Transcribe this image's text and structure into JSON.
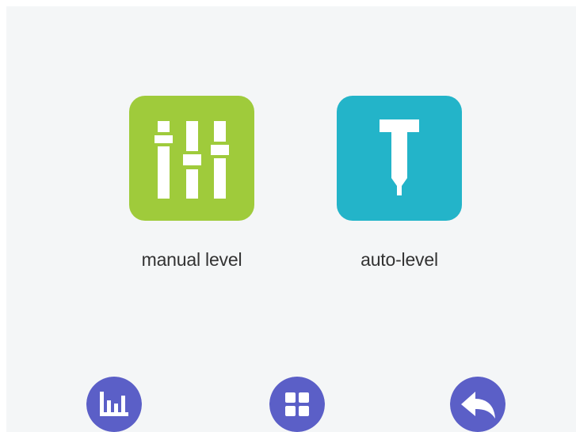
{
  "colors": {
    "background": "#f4f6f7",
    "manual_tile": "#9fcb3b",
    "auto_tile": "#23b4c9",
    "nav_button": "#5b5fc7",
    "icon_fill": "#ffffff",
    "label_text": "#333333"
  },
  "options": [
    {
      "id": "manual-level",
      "label": "manual level",
      "icon": "sliders-icon"
    },
    {
      "id": "auto-level",
      "label": "auto-level",
      "icon": "probe-icon"
    }
  ],
  "nav": [
    {
      "id": "stats",
      "icon": "bar-chart-icon"
    },
    {
      "id": "menu",
      "icon": "grid-icon"
    },
    {
      "id": "back",
      "icon": "back-arrow-icon"
    }
  ]
}
